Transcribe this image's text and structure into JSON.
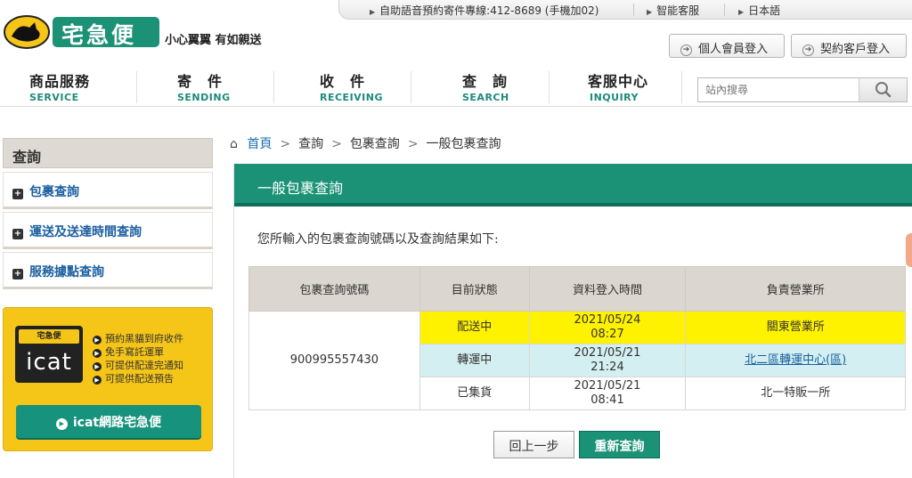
{
  "topbar": {
    "hotline": "自助語音預約寄件專線:412-8689 (手機加02)",
    "smart_service": "智能客服",
    "japanese": "日本語"
  },
  "brand": {
    "logo_text": "宅急便",
    "tagline": "小心翼翼 有如親送"
  },
  "login": {
    "member": "個人會員登入",
    "contract": "契約客戶登入"
  },
  "nav": [
    {
      "zh": "商品服務",
      "en": "SERVICE"
    },
    {
      "zh": "寄　件",
      "en": "SENDING"
    },
    {
      "zh": "收　件",
      "en": "RECEIVING"
    },
    {
      "zh": "查　詢",
      "en": "SEARCH"
    },
    {
      "zh": "客服中心",
      "en": "INQUIRY"
    }
  ],
  "search": {
    "placeholder": "站內搜尋"
  },
  "sidebar": {
    "title": "查詢",
    "items": [
      {
        "label": "包裹查詢"
      },
      {
        "label": "運送及送達時間查詢"
      },
      {
        "label": "服務據點查詢"
      }
    ]
  },
  "icat": {
    "brand": "宅急便",
    "word": "icat",
    "features": [
      "預約黑貓到府收件",
      "免手寫託運單",
      "可提供配達完通知",
      "可提供配送預告"
    ],
    "button": "icat網路宅急便"
  },
  "breadcrumb": [
    "首頁",
    "查詢",
    "包裹查詢",
    "一般包裹查詢"
  ],
  "panel": {
    "title": "一般包裹查詢",
    "intro": "您所輸入的包裹查詢號碼以及查詢結果如下:"
  },
  "table": {
    "headers": [
      "包裹查詢號碼",
      "目前狀態",
      "資料登入時間",
      "負責營業所"
    ],
    "tracking_number": "900995557430",
    "rows": [
      {
        "status": "配送中",
        "date": "2021/05/24",
        "time": "08:27",
        "office": "關東營業所"
      },
      {
        "status": "轉運中",
        "date": "2021/05/21",
        "time": "21:24",
        "office": "北二區轉運中心(區)"
      },
      {
        "status": "已集貨",
        "date": "2021/05/21",
        "time": "08:41",
        "office": "北一特販一所"
      }
    ]
  },
  "buttons": {
    "back": "回上一步",
    "new_query": "重新查詢"
  },
  "colors": {
    "accent": "#1b9176",
    "highlight_yellow": "#fff200",
    "highlight_cyan": "#d4eff1"
  }
}
